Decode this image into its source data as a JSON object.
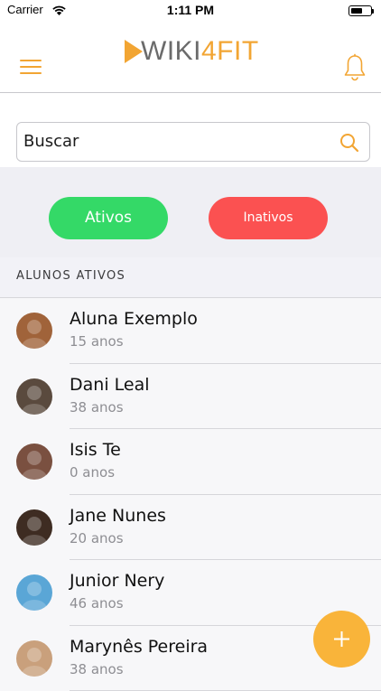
{
  "status_bar": {
    "carrier": "Carrier",
    "time": "1:11 PM",
    "battery_level": 0.65
  },
  "app": {
    "logo_part1": "WIKI",
    "logo_part2": "4FIT"
  },
  "search": {
    "placeholder": "Buscar"
  },
  "filters": {
    "active_label": "Ativos",
    "inactive_label": "Inativos"
  },
  "section": {
    "title": "ALUNOS ATIVOS"
  },
  "students": [
    {
      "name": "Aluna Exemplo",
      "age": "15 anos",
      "avatar_color": "#a0633a"
    },
    {
      "name": "Dani Leal",
      "age": "38 anos",
      "avatar_color": "#5a4a3e"
    },
    {
      "name": "Isis Te",
      "age": "0 anos",
      "avatar_color": "#7a5040"
    },
    {
      "name": "Jane Nunes",
      "age": "20 anos",
      "avatar_color": "#3e2c22"
    },
    {
      "name": "Junior Nery",
      "age": "46 anos",
      "avatar_color": "#5aa6d6"
    },
    {
      "name": "Marynês Pereira",
      "age": "38 anos",
      "avatar_color": "#c9a07c"
    }
  ],
  "colors": {
    "accent": "#f2a533",
    "active": "#34d967",
    "inactive": "#fb5151",
    "fab": "#f9b43a"
  }
}
